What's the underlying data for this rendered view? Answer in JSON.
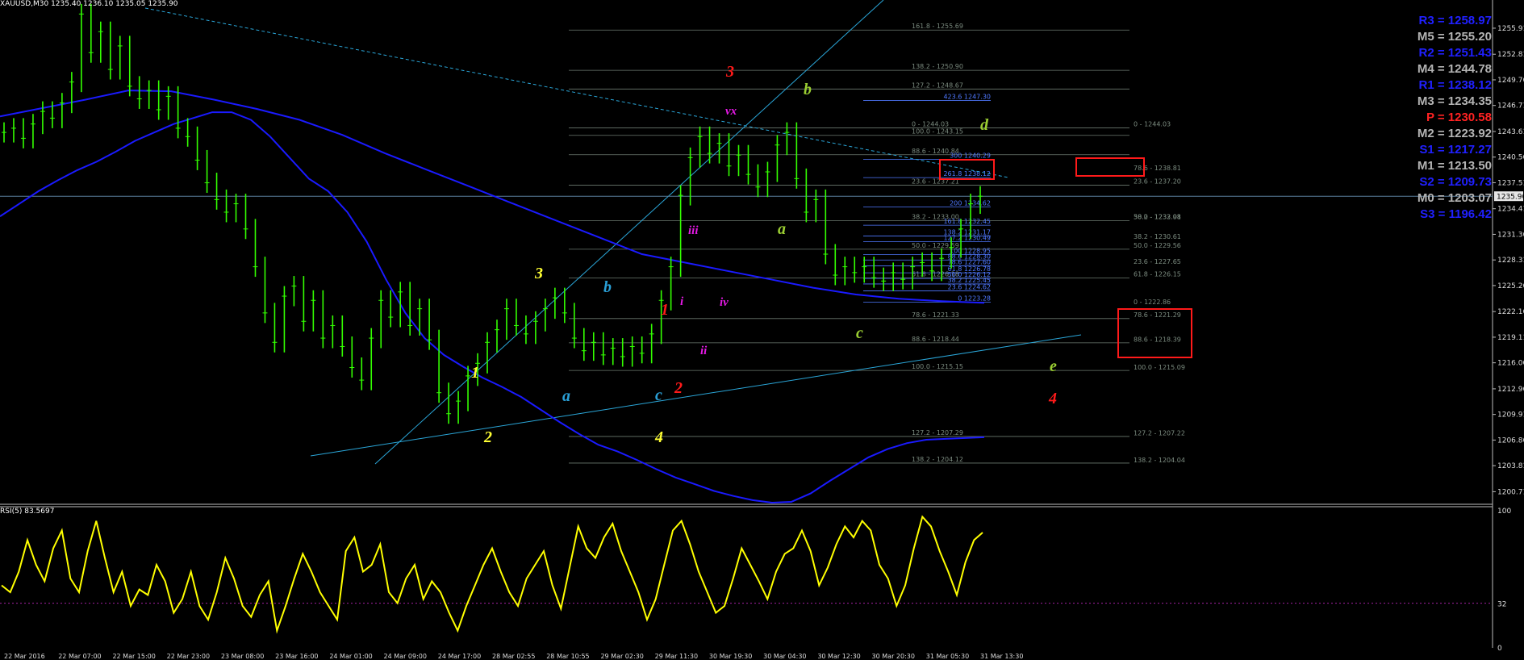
{
  "header": "XAUUSD,M30  1235.40 1236.10 1235.05 1235.90",
  "rsi_label": "RSI(5) 83.5697",
  "colors": {
    "background": "#000000",
    "candle": "#33ff00",
    "ma": "#1a1aff",
    "trendline": "#2aa6d8",
    "fib": "#6c7a70",
    "fib_text_a": "#7c8c80",
    "fib_text_b": "#4f78ff",
    "rsi": "#ffff00",
    "pivot_blue": "#2020ff",
    "pivot_gray": "#b4b4b4",
    "pivot_red": "#ff2222"
  },
  "pivots": [
    {
      "text": "R3 = 1258.97",
      "color": "#2020ff"
    },
    {
      "text": "M5 = 1255.20",
      "color": "#b4b4b4"
    },
    {
      "text": "R2 = 1251.43",
      "color": "#2020ff"
    },
    {
      "text": "M4 = 1244.78",
      "color": "#b4b4b4"
    },
    {
      "text": "R1 = 1238.12",
      "color": "#2020ff"
    },
    {
      "text": "M3 = 1234.35",
      "color": "#b4b4b4"
    },
    {
      "text": "P   = 1230.58",
      "color": "#ff2222"
    },
    {
      "text": "M2 = 1223.92",
      "color": "#b4b4b4"
    },
    {
      "text": "S1 = 1217.27",
      "color": "#2020ff"
    },
    {
      "text": "M1 = 1213.50",
      "color": "#b4b4b4"
    },
    {
      "text": "S2 = 1209.73",
      "color": "#2020ff"
    },
    {
      "text": "M0 = 1203.07",
      "color": "#b4b4b4"
    },
    {
      "text": "S3 = 1196.42",
      "color": "#2020ff"
    }
  ],
  "chart_data": {
    "type": "line",
    "symbol": "XAUUSD",
    "timeframe": "M30",
    "ylim": [
      1199.5,
      1258.5
    ],
    "price_ticks": [
      "1255.91",
      "1252.81",
      "1249.76",
      "1246.71",
      "1243.61",
      "1240.56",
      "1237.51",
      "1234.41",
      "1231.36",
      "1228.31",
      "1225.26",
      "1222.16",
      "1219.11",
      "1216.06",
      "1212.96",
      "1209.91",
      "1206.86",
      "1203.81",
      "1200.71"
    ],
    "current_price": "1235.90",
    "time_labels": [
      "22 Mar 2016",
      "22 Mar 07:00",
      "22 Mar 15:00",
      "22 Mar 23:00",
      "23 Mar 08:00",
      "23 Mar 16:00",
      "24 Mar 01:00",
      "24 Mar 09:00",
      "24 Mar 17:00",
      "28 Mar 02:55",
      "28 Mar 10:55",
      "29 Mar 02:30",
      "29 Mar 11:30",
      "30 Mar 19:30",
      "30 Mar 04:30",
      "30 Mar 12:30",
      "30 Mar 20:30",
      "31 Mar 05:30",
      "31 Mar 13:30"
    ],
    "close_prices": [
      1243.5,
      1244.0,
      1242.8,
      1244.5,
      1246.0,
      1245.2,
      1247.0,
      1249.5,
      1257.6,
      1253.0,
      1255.5,
      1251.0,
      1253.8,
      1249.0,
      1247.5,
      1248.5,
      1246.2,
      1247.8,
      1244.0,
      1243.0,
      1240.2,
      1237.5,
      1235.5,
      1234.0,
      1235.0,
      1232.0,
      1227.5,
      1222.0,
      1218.5,
      1224.0,
      1225.2,
      1221.0,
      1223.5,
      1219.0,
      1220.5,
      1218.0,
      1215.5,
      1214.0,
      1219.0,
      1223.5,
      1221.5,
      1224.5,
      1220.5,
      1222.5,
      1218.8,
      1212.5,
      1210.0,
      1211.5,
      1214.5,
      1216.0,
      1218.5,
      1220.0,
      1222.5,
      1220.5,
      1219.5,
      1221.0,
      1222.5,
      1223.8,
      1222.0,
      1219.0,
      1217.5,
      1218.5,
      1217.0,
      1217.8,
      1216.8,
      1218.0,
      1217.2,
      1219.5,
      1223.5,
      1227.5,
      1236.0,
      1240.5,
      1243.0,
      1241.0,
      1242.2,
      1239.5,
      1240.8,
      1238.5,
      1237.0,
      1238.8,
      1242.0,
      1243.5,
      1238.0,
      1234.0,
      1235.5,
      1229.0,
      1226.5,
      1227.5,
      1226.8,
      1227.5,
      1226.2,
      1225.8,
      1226.8,
      1226.0,
      1227.5,
      1228.0,
      1227.0,
      1228.5,
      1229.8,
      1232.0,
      1235.0,
      1235.9
    ],
    "ma_fast": [
      1233.5,
      1235.0,
      1236.5,
      1237.8,
      1239.0,
      1240.0,
      1241.2,
      1242.5,
      1243.5,
      1244.5,
      1245.2,
      1245.9,
      1245.9,
      1245.0,
      1243.0,
      1240.5,
      1238.0,
      1236.5,
      1234.0,
      1230.5,
      1226.0,
      1222.0,
      1219.0,
      1217.0,
      1215.6,
      1214.3,
      1213.2,
      1212.0,
      1210.5,
      1209.0,
      1207.6,
      1206.3,
      1205.5,
      1204.5,
      1203.4,
      1202.4,
      1201.6,
      1200.8,
      1200.2,
      1199.7,
      1199.4,
      1199.5,
      1200.5,
      1202.0,
      1203.4,
      1204.8,
      1205.8,
      1206.5,
      1206.9,
      1207.0,
      1207.1,
      1207.2
    ],
    "ma_slow": [
      1245.4,
      1246.4,
      1247.4,
      1248.5,
      1248.4,
      1247.4,
      1246.3,
      1245.0,
      1243.2,
      1241.0,
      1239.0,
      1237.0,
      1235.0,
      1233.0,
      1231.0,
      1229.0,
      1228.0,
      1227.0,
      1226.0,
      1225.0,
      1224.2,
      1223.7,
      1223.4,
      1223.2
    ],
    "fibonacci": {
      "column1": [
        {
          "ratio": "161.8",
          "price": "1255.69"
        },
        {
          "ratio": "138.2",
          "price": "1250.90"
        },
        {
          "ratio": "127.2",
          "price": "1248.67"
        },
        {
          "ratio": "0",
          "price": "1244.03"
        },
        {
          "ratio": "100.0",
          "price": "1243.15"
        },
        {
          "ratio": "88.6",
          "price": "1240.84"
        },
        {
          "ratio": "23.6",
          "price": "1237.21"
        },
        {
          "ratio": "38.2",
          "price": "1233.00"
        },
        {
          "ratio": "50.0",
          "price": "1229.59"
        },
        {
          "ratio": "61.8",
          "price": "1226.18"
        },
        {
          "ratio": "78.6",
          "price": "1221.33"
        },
        {
          "ratio": "88.6",
          "price": "1218.44"
        },
        {
          "ratio": "100.0",
          "price": "1215.15"
        },
        {
          "ratio": "127.2",
          "price": "1207.29"
        },
        {
          "ratio": "138.2",
          "price": "1204.12"
        }
      ],
      "column2": [
        {
          "ratio": "0",
          "price": "1244.03"
        },
        {
          "ratio": "78.6",
          "price": "1238.81"
        },
        {
          "ratio": "23.6",
          "price": "1237.20"
        },
        {
          "ratio": "50.0",
          "price": "1233.01"
        },
        {
          "ratio": "38.2",
          "price": "1232.98"
        },
        {
          "ratio": "38.2",
          "price": "1230.61"
        },
        {
          "ratio": "50.0",
          "price": "1229.56"
        },
        {
          "ratio": "23.6",
          "price": "1227.65"
        },
        {
          "ratio": "61.8",
          "price": "1226.15"
        },
        {
          "ratio": "0",
          "price": "1222.86"
        },
        {
          "ratio": "78.6",
          "price": "1221.29"
        },
        {
          "ratio": "88.6",
          "price": "1218.39"
        },
        {
          "ratio": "100.0",
          "price": "1215.09"
        },
        {
          "ratio": "127.2",
          "price": "1207.22"
        },
        {
          "ratio": "138.2",
          "price": "1204.04"
        }
      ],
      "extensions": [
        {
          "ratio": "423.6",
          "price": "1247.30"
        },
        {
          "ratio": "300",
          "price": "1240.29"
        },
        {
          "ratio": "261.8",
          "price": "1238.12"
        },
        {
          "ratio": "200",
          "price": "1234.62"
        },
        {
          "ratio": "161.8",
          "price": "1232.45"
        },
        {
          "ratio": "138.2",
          "price": "1231.17"
        },
        {
          "ratio": "127.2",
          "price": "1230.49"
        },
        {
          "ratio": "100",
          "price": "1228.95"
        },
        {
          "ratio": "88.6",
          "price": "1228.30"
        },
        {
          "ratio": "78.6",
          "price": "1227.60"
        },
        {
          "ratio": "61.8",
          "price": "1226.78"
        },
        {
          "ratio": "50.0",
          "price": "1226.12"
        },
        {
          "ratio": "38.2",
          "price": "1225.45"
        },
        {
          "ratio": "23.6",
          "price": "1224.62"
        },
        {
          "ratio": "0",
          "price": "1223.28"
        }
      ]
    },
    "wave_labels": [
      {
        "text": "1",
        "color": "#ffff33"
      },
      {
        "text": "2",
        "color": "#ffff33"
      },
      {
        "text": "3",
        "color": "#ffff33"
      },
      {
        "text": "4",
        "color": "#ffff33"
      },
      {
        "text": "a",
        "color": "#2a9fd6"
      },
      {
        "text": "b",
        "color": "#2a9fd6"
      },
      {
        "text": "c",
        "color": "#2a9fd6"
      },
      {
        "text": "1",
        "color": "#ff1a1a"
      },
      {
        "text": "2",
        "color": "#ff1a1a"
      },
      {
        "text": "3",
        "color": "#ff1a1a"
      },
      {
        "text": "4",
        "color": "#ff1a1a"
      },
      {
        "text": "i",
        "color": "#e619e6"
      },
      {
        "text": "ii",
        "color": "#e619e6"
      },
      {
        "text": "iii",
        "color": "#e619e6"
      },
      {
        "text": "iv",
        "color": "#e619e6"
      },
      {
        "text": "vx",
        "color": "#e619e6"
      },
      {
        "text": "a",
        "color": "#9acd32"
      },
      {
        "text": "b",
        "color": "#9acd32"
      },
      {
        "text": "c",
        "color": "#9acd32"
      },
      {
        "text": "d",
        "color": "#9acd32"
      },
      {
        "text": "e",
        "color": "#9acd32"
      }
    ],
    "rsi": {
      "period": 5,
      "value": 83.5697,
      "ylim": [
        0,
        100
      ],
      "levels": [
        "100",
        "32",
        "0"
      ],
      "values": [
        45,
        40,
        55,
        78,
        60,
        48,
        72,
        85,
        50,
        40,
        70,
        92,
        65,
        40,
        55,
        30,
        42,
        38,
        60,
        48,
        25,
        35,
        55,
        30,
        20,
        40,
        65,
        50,
        30,
        22,
        38,
        48,
        12,
        30,
        50,
        68,
        55,
        40,
        30,
        20,
        70,
        80,
        55,
        60,
        75,
        40,
        32,
        50,
        60,
        35,
        48,
        40,
        25,
        12,
        30,
        45,
        60,
        72,
        55,
        40,
        30,
        50,
        60,
        70,
        45,
        28,
        58,
        88,
        72,
        65,
        80,
        90,
        70,
        55,
        40,
        20,
        35,
        60,
        85,
        92,
        75,
        55,
        40,
        25,
        30,
        50,
        72,
        60,
        48,
        35,
        55,
        68,
        72,
        85,
        70,
        45,
        58,
        75,
        88,
        80,
        92,
        85,
        60,
        50,
        30,
        45,
        72,
        95,
        88,
        70,
        55,
        38,
        62,
        78,
        83.5
      ]
    }
  }
}
